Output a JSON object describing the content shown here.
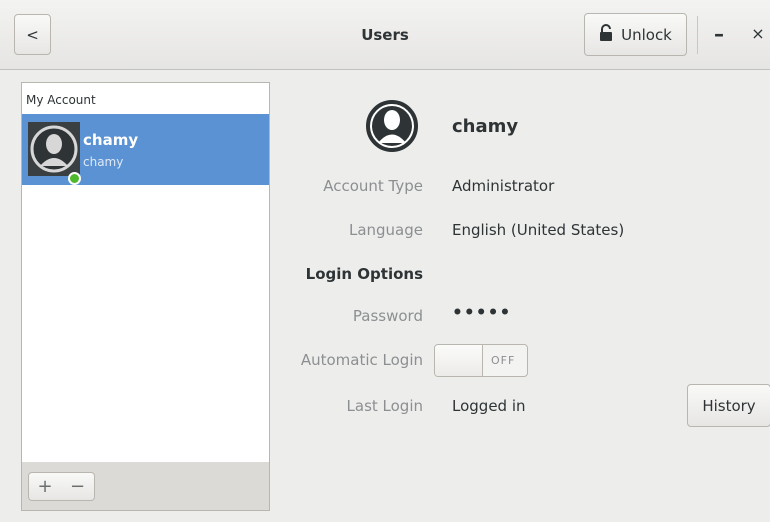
{
  "window": {
    "title": "Users",
    "back_glyph": "<",
    "unlock_label": "Unlock",
    "minimize_glyph": "–",
    "close_glyph": "×"
  },
  "sidebar": {
    "section_label": "My Account",
    "users": [
      {
        "name": "chamy",
        "username": "chamy",
        "selected": true,
        "online": true
      }
    ],
    "add_glyph": "+",
    "remove_glyph": "−"
  },
  "details": {
    "name": "chamy",
    "account_type_label": "Account Type",
    "account_type_value": "Administrator",
    "language_label": "Language",
    "language_value": "English (United States)",
    "login_options_label": "Login Options",
    "password_label": "Password",
    "password_value": "•••••",
    "auto_login_label": "Automatic Login",
    "auto_login_state": "OFF",
    "last_login_label": "Last Login",
    "last_login_value": "Logged in",
    "history_label": "History"
  },
  "colors": {
    "selection": "#5a92d3",
    "online": "#4dba2d"
  },
  "icons": [
    "back-icon",
    "lock-icon",
    "avatar-icon",
    "minimize-icon",
    "close-icon",
    "add-icon",
    "remove-icon"
  ]
}
